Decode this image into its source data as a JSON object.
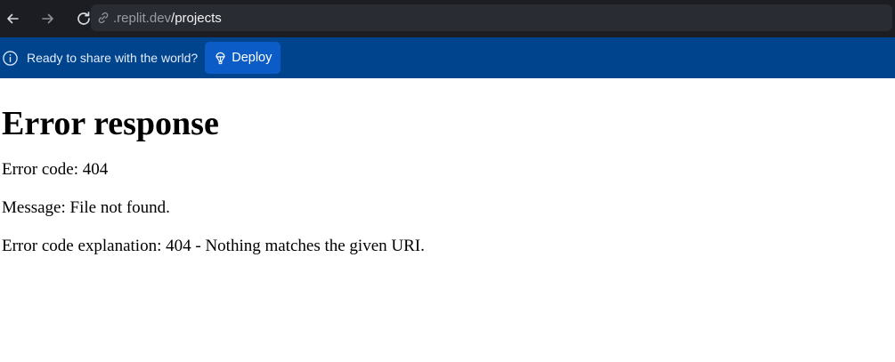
{
  "browser": {
    "url_host": ".replit.dev",
    "url_path": "/projects",
    "icons": [
      "back-arrow-icon",
      "forward-arrow-icon",
      "reload-icon",
      "link-icon"
    ]
  },
  "banner": {
    "message": "Ready to share with the world?",
    "deploy_label": "Deploy",
    "colors": {
      "background": "#00448e",
      "button": "#0b5cc6"
    }
  },
  "page": {
    "title": "Error response",
    "error_code": "Error code: 404",
    "message": "Message: File not found.",
    "explanation": "Error code explanation: 404 - Nothing matches the given URI."
  }
}
